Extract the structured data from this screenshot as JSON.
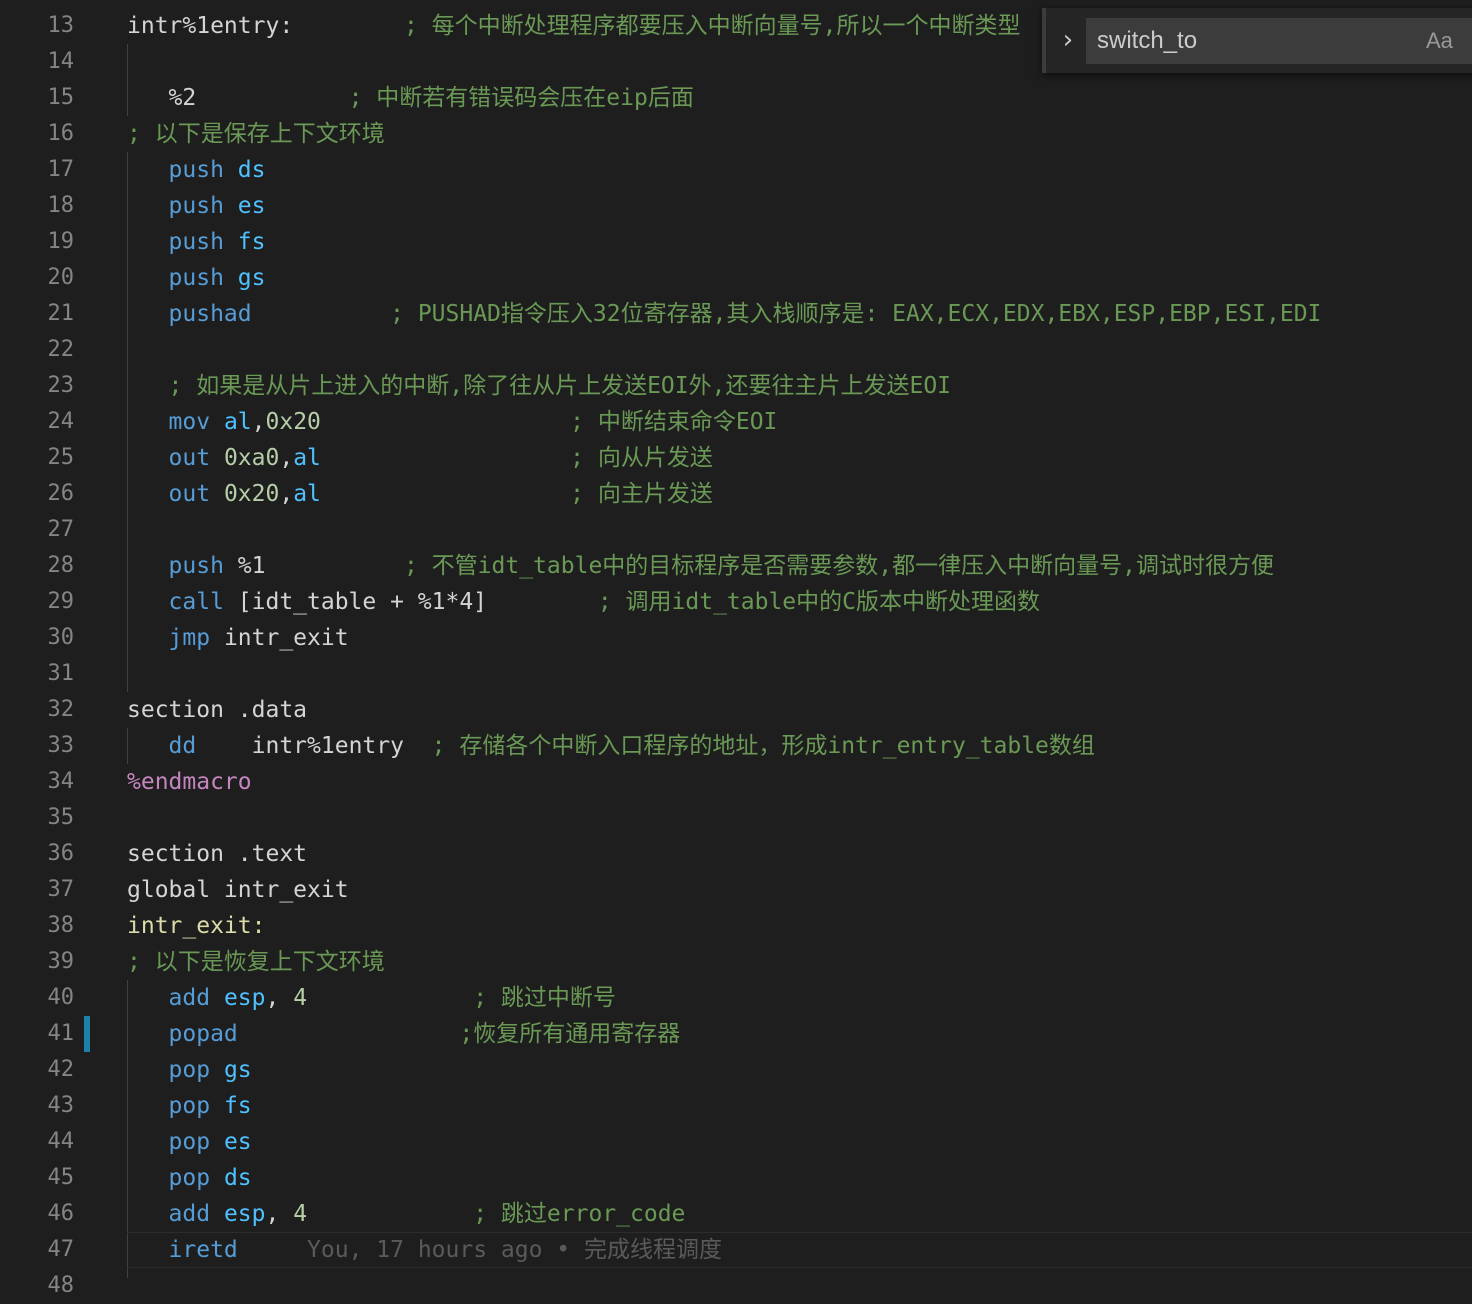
{
  "lines": [
    {
      "n": "13",
      "segs": [
        [
          "t",
          "intr%1entry:"
        ],
        [
          "t",
          "        "
        ],
        [
          "cm",
          "; 每个中断处理程序都要压入中断向量号,所以一个中断类型"
        ]
      ]
    },
    {
      "n": "14",
      "segs": []
    },
    {
      "n": "15",
      "segs": [
        [
          "t",
          "   %2"
        ],
        [
          "t",
          "           "
        ],
        [
          "cm",
          "; 中断若有错误码会压在eip后面"
        ]
      ]
    },
    {
      "n": "16",
      "segs": [
        [
          "cm",
          "; 以下是保存上下文环境"
        ]
      ]
    },
    {
      "n": "17",
      "segs": [
        [
          "t",
          "   "
        ],
        [
          "kw",
          "push"
        ],
        [
          "t",
          " "
        ],
        [
          "mn",
          "ds"
        ]
      ]
    },
    {
      "n": "18",
      "segs": [
        [
          "t",
          "   "
        ],
        [
          "kw",
          "push"
        ],
        [
          "t",
          " "
        ],
        [
          "mn",
          "es"
        ]
      ]
    },
    {
      "n": "19",
      "segs": [
        [
          "t",
          "   "
        ],
        [
          "kw",
          "push"
        ],
        [
          "t",
          " "
        ],
        [
          "mn",
          "fs"
        ]
      ]
    },
    {
      "n": "20",
      "segs": [
        [
          "t",
          "   "
        ],
        [
          "kw",
          "push"
        ],
        [
          "t",
          " "
        ],
        [
          "mn",
          "gs"
        ]
      ]
    },
    {
      "n": "21",
      "segs": [
        [
          "t",
          "   "
        ],
        [
          "kw",
          "pushad"
        ],
        [
          "t",
          "          "
        ],
        [
          "cm",
          "; PUSHAD指令压入32位寄存器,其入栈顺序是: EAX,ECX,EDX,EBX,ESP,EBP,ESI,EDI"
        ]
      ]
    },
    {
      "n": "22",
      "segs": []
    },
    {
      "n": "23",
      "segs": [
        [
          "t",
          "   "
        ],
        [
          "cm",
          "; 如果是从片上进入的中断,除了往从片上发送EOI外,还要往主片上发送EOI"
        ]
      ]
    },
    {
      "n": "24",
      "segs": [
        [
          "t",
          "   "
        ],
        [
          "kw",
          "mov"
        ],
        [
          "t",
          " "
        ],
        [
          "mn",
          "al"
        ],
        [
          "t",
          ","
        ],
        [
          "num",
          "0x20"
        ],
        [
          "t",
          "                  "
        ],
        [
          "cm",
          "; 中断结束命令EOI"
        ]
      ]
    },
    {
      "n": "25",
      "segs": [
        [
          "t",
          "   "
        ],
        [
          "kw",
          "out"
        ],
        [
          "t",
          " "
        ],
        [
          "num",
          "0xa0"
        ],
        [
          "t",
          ","
        ],
        [
          "mn",
          "al"
        ],
        [
          "t",
          "                  "
        ],
        [
          "cm",
          "; 向从片发送"
        ]
      ]
    },
    {
      "n": "26",
      "segs": [
        [
          "t",
          "   "
        ],
        [
          "kw",
          "out"
        ],
        [
          "t",
          " "
        ],
        [
          "num",
          "0x20"
        ],
        [
          "t",
          ","
        ],
        [
          "mn",
          "al"
        ],
        [
          "t",
          "                  "
        ],
        [
          "cm",
          "; 向主片发送"
        ]
      ]
    },
    {
      "n": "27",
      "segs": []
    },
    {
      "n": "28",
      "segs": [
        [
          "t",
          "   "
        ],
        [
          "kw",
          "push"
        ],
        [
          "t",
          " %1"
        ],
        [
          "t",
          "          "
        ],
        [
          "cm",
          "; 不管idt_table中的目标程序是否需要参数,都一律压入中断向量号,调试时很方便"
        ]
      ]
    },
    {
      "n": "29",
      "segs": [
        [
          "t",
          "   "
        ],
        [
          "kw",
          "call"
        ],
        [
          "t",
          " [idt_table + %1*4]"
        ],
        [
          "t",
          "        "
        ],
        [
          "cm",
          "; 调用idt_table中的C版本中断处理函数"
        ]
      ]
    },
    {
      "n": "30",
      "segs": [
        [
          "t",
          "   "
        ],
        [
          "kw",
          "jmp"
        ],
        [
          "t",
          " intr_exit"
        ]
      ]
    },
    {
      "n": "31",
      "segs": []
    },
    {
      "n": "32",
      "segs": [
        [
          "t",
          "section .data"
        ]
      ]
    },
    {
      "n": "33",
      "segs": [
        [
          "t",
          "   "
        ],
        [
          "kw",
          "dd"
        ],
        [
          "t",
          "    intr%1entry  "
        ],
        [
          "cm",
          "; 存储各个中断入口程序的地址，形成intr_entry_table数组"
        ]
      ]
    },
    {
      "n": "34",
      "segs": [
        [
          "mac",
          "%endmacro"
        ]
      ]
    },
    {
      "n": "35",
      "segs": []
    },
    {
      "n": "36",
      "segs": [
        [
          "t",
          "section .text"
        ]
      ]
    },
    {
      "n": "37",
      "segs": [
        [
          "t",
          "global intr_exit"
        ]
      ]
    },
    {
      "n": "38",
      "segs": [
        [
          "lbl",
          "intr_exit:"
        ]
      ]
    },
    {
      "n": "39",
      "segs": [
        [
          "cm",
          "; 以下是恢复上下文环境"
        ]
      ]
    },
    {
      "n": "40",
      "segs": [
        [
          "t",
          "   "
        ],
        [
          "kw",
          "add"
        ],
        [
          "t",
          " "
        ],
        [
          "mn",
          "esp"
        ],
        [
          "t",
          ", "
        ],
        [
          "num",
          "4"
        ],
        [
          "t",
          "            "
        ],
        [
          "cm",
          "; 跳过中断号"
        ]
      ]
    },
    {
      "n": "41",
      "segs": [
        [
          "t",
          "   "
        ],
        [
          "kw",
          "popad"
        ],
        [
          "t",
          "                "
        ],
        [
          "cm",
          ";恢复所有通用寄存器"
        ]
      ]
    },
    {
      "n": "42",
      "segs": [
        [
          "t",
          "   "
        ],
        [
          "kw",
          "pop"
        ],
        [
          "t",
          " "
        ],
        [
          "mn",
          "gs"
        ]
      ]
    },
    {
      "n": "43",
      "segs": [
        [
          "t",
          "   "
        ],
        [
          "kw",
          "pop"
        ],
        [
          "t",
          " "
        ],
        [
          "mn",
          "fs"
        ]
      ]
    },
    {
      "n": "44",
      "segs": [
        [
          "t",
          "   "
        ],
        [
          "kw",
          "pop"
        ],
        [
          "t",
          " "
        ],
        [
          "mn",
          "es"
        ]
      ]
    },
    {
      "n": "45",
      "segs": [
        [
          "t",
          "   "
        ],
        [
          "kw",
          "pop"
        ],
        [
          "t",
          " "
        ],
        [
          "mn",
          "ds"
        ]
      ]
    },
    {
      "n": "46",
      "segs": [
        [
          "t",
          "   "
        ],
        [
          "kw",
          "add"
        ],
        [
          "t",
          " "
        ],
        [
          "mn",
          "esp"
        ],
        [
          "t",
          ", "
        ],
        [
          "num",
          "4"
        ],
        [
          "t",
          "            "
        ],
        [
          "cm",
          "; 跳过error_code"
        ]
      ]
    },
    {
      "n": "47",
      "segs": [
        [
          "t",
          "   "
        ],
        [
          "kw",
          "iretd"
        ],
        [
          "t",
          "     "
        ],
        [
          "blame",
          "You, 17 hours ago • 完成线程调度"
        ]
      ]
    },
    {
      "n": "48",
      "segs": []
    }
  ],
  "find_widget": {
    "query": "switch_to",
    "match_case_label": "Aa",
    "toggle_icon": "chevron-right-icon"
  },
  "colors": {
    "background": "#1e1e1e",
    "keyword": "#569cd6",
    "register": "#4fc1ff",
    "comment": "#6a9955",
    "number": "#b5cea8",
    "macro": "#c586c0",
    "label": "#dcdcaa",
    "modified_indicator": "#1b81a8"
  }
}
